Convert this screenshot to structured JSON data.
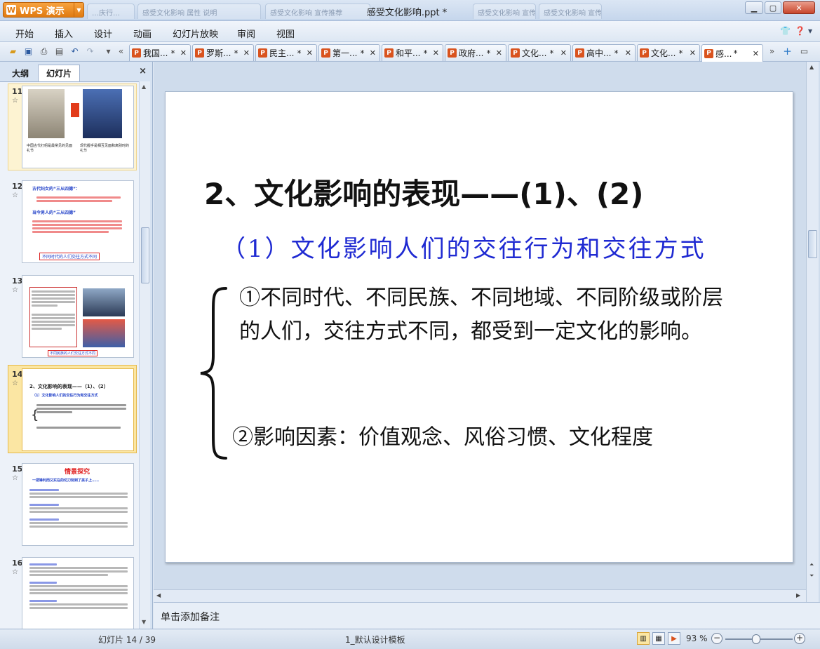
{
  "app": {
    "logo_text": "WPS 演示",
    "window_title": "感受文化影响.ppt *",
    "background_tabs": [
      "…庆行…",
      "感受文化影响 属性 说明",
      "感受文化影响 宣传推荐",
      "感受文化影响 宣传推荐",
      "感受文化影响 宣传推荐"
    ]
  },
  "menu": {
    "items": [
      "开始",
      "插入",
      "设计",
      "动画",
      "幻灯片放映",
      "审阅",
      "视图"
    ]
  },
  "doc_tabs": [
    {
      "label": "我国...",
      "active": false
    },
    {
      "label": "罗斯...",
      "active": false
    },
    {
      "label": "民主...",
      "active": false
    },
    {
      "label": "第一...",
      "active": false
    },
    {
      "label": "和平...",
      "active": false
    },
    {
      "label": "政府...",
      "active": false
    },
    {
      "label": "文化...",
      "active": false
    },
    {
      "label": "高中...",
      "active": false
    },
    {
      "label": "文化...",
      "active": false
    },
    {
      "label": "感...",
      "active": true
    }
  ],
  "left_panel": {
    "tab_outline": "大纲",
    "tab_slides": "幻灯片",
    "close": "×"
  },
  "thumbnails": [
    {
      "num": "11",
      "caption_left": "中国古代打躬是最常见的见面礼节",
      "caption_right": "现代握手是相互见面和离别时的礼节"
    },
    {
      "num": "12",
      "heading1": "古代妇女的“三从四德”：",
      "heading2": "当今男人的“三从四德”",
      "footer": "不同时代的人们交往方式不同"
    },
    {
      "num": "13",
      "footer": "不同民族的人们交往方式不同"
    },
    {
      "num": "14",
      "title": "2、文化影响的表现——（1）、（2）",
      "sub": "（1）文化影响人们的交往行为和交往方式"
    },
    {
      "num": "15",
      "title": "情景探究",
      "sub": "一把锋利而又实在的切刀刻到了孩子上……"
    },
    {
      "num": "16"
    }
  ],
  "slide": {
    "title": "2、文化影响的表现——(1)、(2)",
    "subtitle": "（1）文化影响人们的交往行为和交往方式",
    "point1": "①不同时代、不同民族、不同地域、不同阶级或阶层的人们，交往方式不同，都受到一定文化的影响。",
    "point2": "②影响因素：价值观念、风俗习惯、文化程度"
  },
  "notes_placeholder": "单击添加备注",
  "status": {
    "slide_counter": "幻灯片 14 / 39",
    "template": "1_默认设计模板",
    "zoom": "93 %"
  },
  "colors": {
    "accent_blue": "#1f2ad2",
    "logo_orange": "#e07a10",
    "selection": "#fbe6a3"
  }
}
